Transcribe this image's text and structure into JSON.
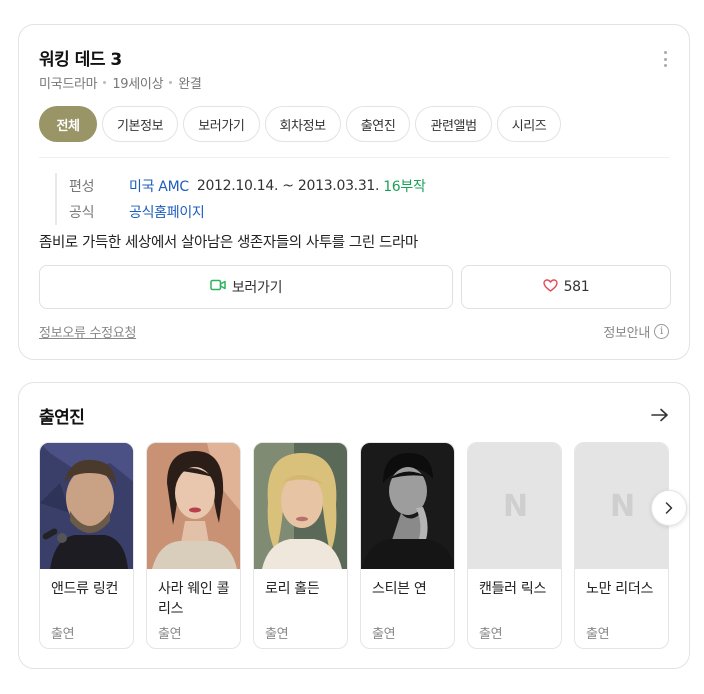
{
  "header": {
    "title": "워킹 데드 3",
    "meta": [
      "미국드라마",
      "19세이상",
      "완결"
    ]
  },
  "tabs": [
    {
      "label": "전체",
      "active": true
    },
    {
      "label": "기본정보"
    },
    {
      "label": "보러가기"
    },
    {
      "label": "회차정보"
    },
    {
      "label": "출연진"
    },
    {
      "label": "관련앨범"
    },
    {
      "label": "시리즈"
    }
  ],
  "info": {
    "schedule_label": "편성",
    "channel": "미국 AMC",
    "period": "2012.10.14. ~ 2013.03.31.",
    "episodes": "16부작",
    "official_label": "공식",
    "official_link": "공식홈페이지"
  },
  "description": "좀비로 가득한 세상에서 살아남은 생존자들의 사투를 그린 드라마",
  "actions": {
    "watch_label": "보러가기",
    "like_count": "581"
  },
  "footer": {
    "report_label": "정보오류 수정요청",
    "guide_label": "정보안내"
  },
  "cast": {
    "title": "출연진",
    "members": [
      {
        "name": "앤드류 링컨",
        "role": "출연",
        "photo": "photo"
      },
      {
        "name": "사라 웨인 콜리스",
        "role": "출연",
        "photo": "photo"
      },
      {
        "name": "로리 홀든",
        "role": "출연",
        "photo": "photo"
      },
      {
        "name": "스티븐 연",
        "role": "출연",
        "photo": "photo"
      },
      {
        "name": "캔들러 릭스",
        "role": "출연",
        "photo": "placeholder"
      },
      {
        "name": "노만 리더스",
        "role": "출연",
        "photo": "placeholder"
      }
    ],
    "placeholder_glyph": "N"
  },
  "colors": {
    "accent": "#9a9566",
    "link": "#1e5cbd",
    "green": "#1aa157",
    "heart": "#e24a55",
    "camera": "#2db35c"
  },
  "icons": [
    "more-icon",
    "camera-icon",
    "heart-icon",
    "info-icon",
    "arrow-right-icon",
    "chevron-right-icon"
  ]
}
